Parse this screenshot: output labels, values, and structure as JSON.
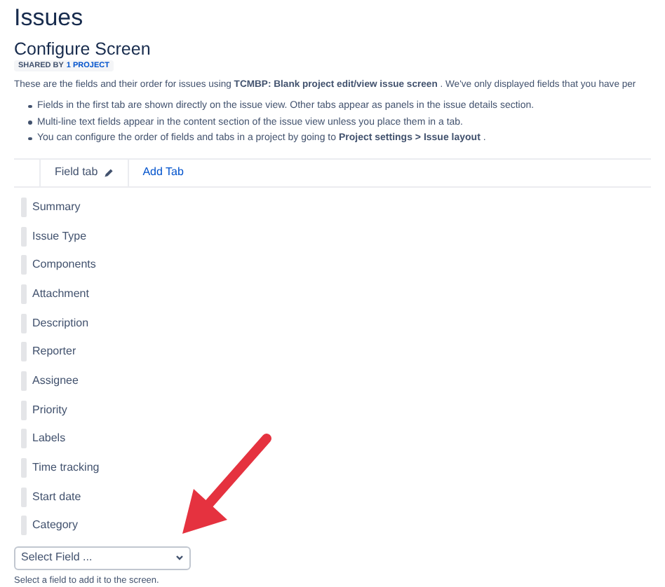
{
  "page_title": "Issues",
  "screen": {
    "title": "Configure Screen",
    "badge": {
      "label": "SHARED BY",
      "link": "1 PROJECT"
    },
    "description": "These are the fields and their order for issues using **TCMBP: Blank project edit/view issue screen** . We've only displayed fields that you have per",
    "bullets": [
      "Fields in the first tab are shown directly on the issue view. Other tabs appear as panels in the issue details section.",
      "Multi-line text fields appear in the content section of the issue view unless you place them in a tab.",
      "You can configure the order of fields and tabs in a project by going to **Project settings > Issue layout** ."
    ]
  },
  "tabs": [
    {
      "label": "Field tab",
      "selected": true
    },
    {
      "label": "Add Tab",
      "selected": false
    }
  ],
  "fields": [
    "Summary",
    "Issue Type",
    "Components",
    "Attachment",
    "Description",
    "Reporter",
    "Assignee",
    "Priority",
    "Labels",
    "Time tracking",
    "Start date",
    "Category"
  ],
  "select": {
    "placeholder": "Select Field ...",
    "hint": "Select a field to add it to the screen."
  }
}
